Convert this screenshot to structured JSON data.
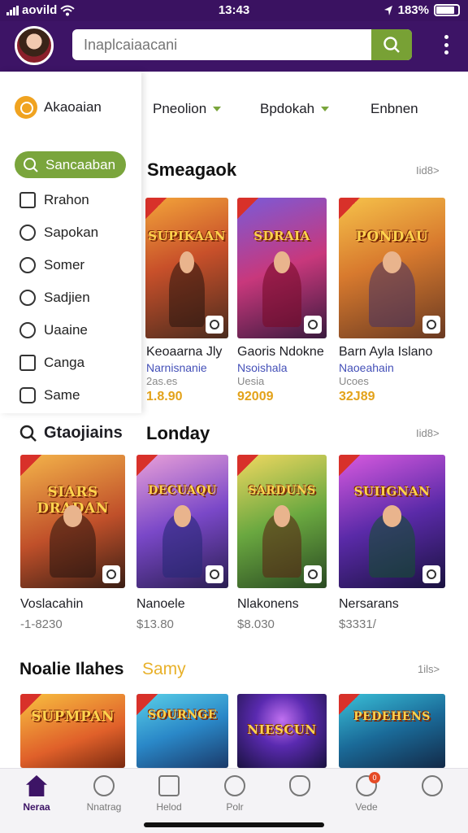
{
  "status_bar": {
    "carrier": "aovild",
    "time": "13:43",
    "battery": "183%"
  },
  "header": {
    "search_placeholder": "Inaplcaiaacani"
  },
  "drawer": {
    "brand": "Akaoaian",
    "active_item": "Sancaaban",
    "items": [
      {
        "label": "Rrahon",
        "icon": "grid-icon"
      },
      {
        "label": "Sapokan",
        "icon": "coin-icon"
      },
      {
        "label": "Somer",
        "icon": "chat-icon"
      },
      {
        "label": "Sadjien",
        "icon": "search-icon"
      },
      {
        "label": "Uaaine",
        "icon": "star-icon"
      },
      {
        "label": "Canga",
        "icon": "calendar-icon"
      },
      {
        "label": "Same",
        "icon": "circle-icon"
      }
    ]
  },
  "tabs": [
    {
      "label": "Pneolion"
    },
    {
      "label": "Bpdokah"
    },
    {
      "label": "Enbnen"
    }
  ],
  "section1": {
    "title": "Smeagaok",
    "more": "Iid8>",
    "cards": [
      {
        "art_title": "SUPIKAAN",
        "name": "Keoaarna Jly",
        "sub": "Narnisnanie",
        "meta": "2as.es",
        "price": "1.8.90"
      },
      {
        "art_title": "SDRAIA",
        "name": "Gaoris Ndokne",
        "sub": "Nsoishala",
        "meta": "Uesia",
        "price": "92009"
      },
      {
        "art_title": "PONDAU",
        "name": "Barn Ayla Islano",
        "sub": "Naoeahain",
        "meta": "Ucoes",
        "price": "32J89"
      }
    ]
  },
  "section2": {
    "label": "Gtaojiains",
    "title": "Londay",
    "more": "Iid8>",
    "cards": [
      {
        "art_title": "SIARS DRADAN",
        "name": "Voslacahin",
        "price": "-1-8230"
      },
      {
        "art_title": "DECUAQU",
        "name": "Nanoele",
        "price": "$13.80"
      },
      {
        "art_title": "SARDUNS",
        "name": "Nlakonens",
        "price": "$8.030"
      },
      {
        "art_title": "SUIIGNAN",
        "name": "Nersarans",
        "price": "$3331/"
      }
    ]
  },
  "section3": {
    "title": "Noalie Ilahes",
    "accent_title": "Samy",
    "more": "1ils>",
    "cards": [
      {
        "art_title": "SUPMPAN"
      },
      {
        "art_title": "SOURNGE"
      },
      {
        "art_title": "NIESCUN"
      },
      {
        "art_title": "PEDEHENS"
      }
    ]
  },
  "bottom_nav": [
    {
      "label": "Neraa",
      "icon": "home-icon"
    },
    {
      "label": "Nnatrag",
      "icon": "person-icon"
    },
    {
      "label": "Helod",
      "icon": "message-icon"
    },
    {
      "label": "Polr",
      "icon": "controller-icon"
    },
    {
      "label": "",
      "icon": "hand-icon"
    },
    {
      "label": "Vede",
      "icon": "notification-icon",
      "badge": "0"
    },
    {
      "label": "",
      "icon": "profile-icon"
    }
  ],
  "colors": {
    "brand_purple": "#3d1466",
    "accent_green": "#7aa53c",
    "price_gold": "#e3a21a"
  }
}
